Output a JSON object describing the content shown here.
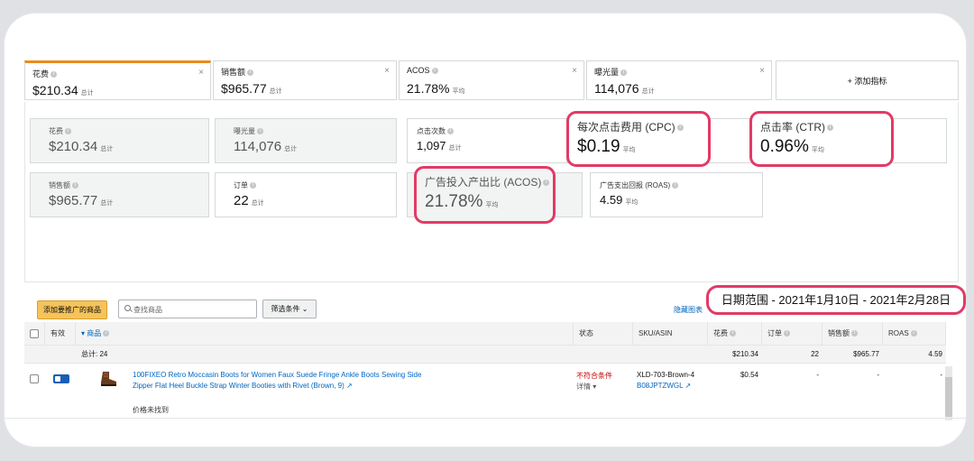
{
  "metrics_bar": [
    {
      "label": "花费",
      "value": "$210.34",
      "suffix": "总计",
      "active": true
    },
    {
      "label": "销售额",
      "value": "$965.77",
      "suffix": "总计",
      "active": false
    },
    {
      "label": "ACOS",
      "value": "21.78%",
      "suffix": "平均",
      "active": false
    },
    {
      "label": "曝光量",
      "value": "114,076",
      "suffix": "总计",
      "active": false
    }
  ],
  "add_metric_label": "+ 添加指标",
  "tiles": {
    "spend": {
      "label": "花费",
      "value": "$210.34",
      "suffix": "总计"
    },
    "impressions": {
      "label": "曝光量",
      "value": "114,076",
      "suffix": "总计"
    },
    "clicks": {
      "label": "点击次数",
      "value": "1,097",
      "suffix": "总计"
    },
    "cpc": {
      "label": "每次点击费用 (CPC)",
      "value": "$0.19",
      "suffix": "平均"
    },
    "ctr": {
      "label": "点击率 (CTR)",
      "value": "0.96%",
      "suffix": "平均"
    },
    "sales": {
      "label": "销售额",
      "value": "$965.77",
      "suffix": "总计"
    },
    "orders": {
      "label": "订单",
      "value": "22",
      "suffix": "总计"
    },
    "acos": {
      "label": "广告投入产出比 (ACOS)",
      "value": "21.78%",
      "suffix": "平均"
    },
    "roas": {
      "label": "广告支出回报 (ROAS)",
      "value": "4.59",
      "suffix": "平均"
    }
  },
  "toolbar": {
    "add_products": "添加要推广的商品",
    "search_placeholder": "查找商品",
    "filter_label": "筛选条件 ⌄",
    "hide_chart": "隐藏图表",
    "date_range": "日期范围 - 2021年1月10日 - 2021年2月28日"
  },
  "table": {
    "headers": {
      "active": "有效",
      "product": "▾ 商品",
      "status": "状态",
      "sku": "SKU/ASIN",
      "spend": "花费",
      "orders": "订单",
      "sales": "销售额",
      "roas": "ROAS"
    },
    "total_row": {
      "label": "总计: 24",
      "spend": "$210.34",
      "orders": "22",
      "sales": "$965.77",
      "roas": "4.59"
    },
    "rows": [
      {
        "title_line1": "100FIXEO Retro Moccasin Boots for Women Faux Suede Fringe Ankle Boots Sewing Side",
        "title_line2": "Zipper Flat Heel Buckle Strap Winter Booties with Rivet (Brown, 9)",
        "note": "价格未找到",
        "status": "不符合条件",
        "status_detail": "详情 ▾",
        "sku": "XLD-703-Brown-4",
        "asin": "B08JPTZWGL",
        "spend": "$0.54",
        "orders": "-",
        "sales": "-",
        "roas": "-"
      }
    ]
  },
  "colors": {
    "accent_orange": "#e88d1f",
    "highlight": "#e23a66",
    "link": "#0066c0",
    "add_button": "#f5c35a"
  }
}
